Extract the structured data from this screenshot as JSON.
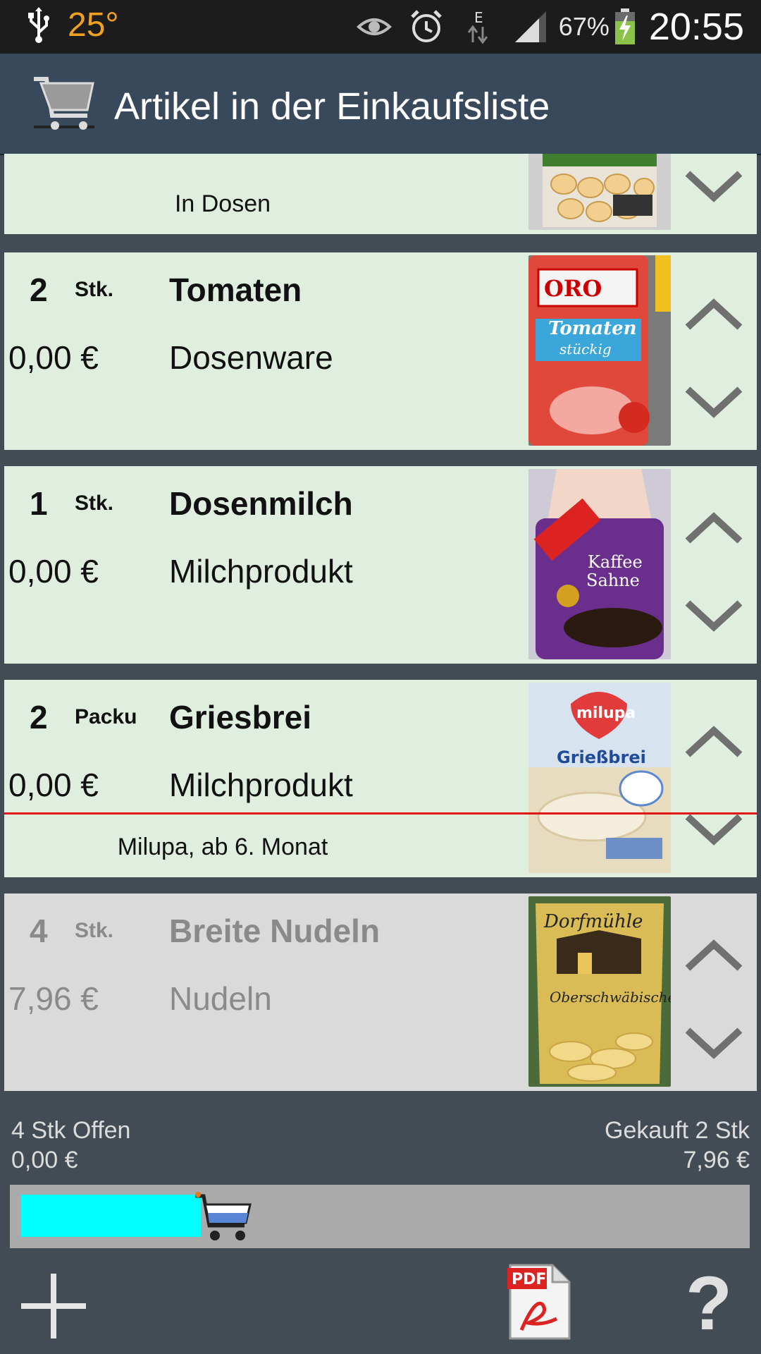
{
  "status_bar": {
    "temperature": "25°",
    "battery_percent": "67%",
    "time": "20:55",
    "icons": [
      "usb-icon",
      "eye-icon",
      "alarm-icon",
      "edge-data-icon",
      "signal-icon",
      "battery-charging-icon"
    ]
  },
  "action_bar": {
    "title": "Artikel in der Einkaufsliste",
    "icon": "shopping-cart-icon"
  },
  "items": [
    {
      "qty": "",
      "unit": "",
      "name": "",
      "price": "",
      "category": "",
      "note": "In Dosen",
      "bought": false,
      "image": "canned-beans"
    },
    {
      "qty": "2",
      "unit": "Stk.",
      "name": "Tomaten",
      "price": "0,00 €",
      "category": "Dosenware",
      "note": "",
      "bought": false,
      "image": "canned-tomatoes"
    },
    {
      "qty": "1",
      "unit": "Stk.",
      "name": "Dosenmilch",
      "price": "0,00 €",
      "category": "Milchprodukt",
      "note": "",
      "bought": false,
      "image": "coffee-cream"
    },
    {
      "qty": "2",
      "unit": "Packu",
      "name": "Griesbrei",
      "price": "0,00 €",
      "category": "Milchprodukt",
      "note": "Milupa, ab 6. Monat",
      "bought": false,
      "image": "semolina-porridge"
    },
    {
      "qty": "4",
      "unit": "Stk.",
      "name": "Breite Nudeln",
      "price": "7,96 €",
      "category": "Nudeln",
      "note": "",
      "bought": true,
      "image": "noodles-bag"
    }
  ],
  "summary": {
    "open_count": "4 Stk  Offen",
    "open_total": "0,00 €",
    "bought_count": "Gekauft  2 Stk",
    "bought_total": "7,96 €"
  },
  "progress": {
    "fraction": 0.25,
    "fill_color": "#00ffff"
  },
  "bottom_bar": {
    "help_label": "?",
    "icons": [
      "add-icon",
      "pdf-icon",
      "help-icon"
    ]
  }
}
